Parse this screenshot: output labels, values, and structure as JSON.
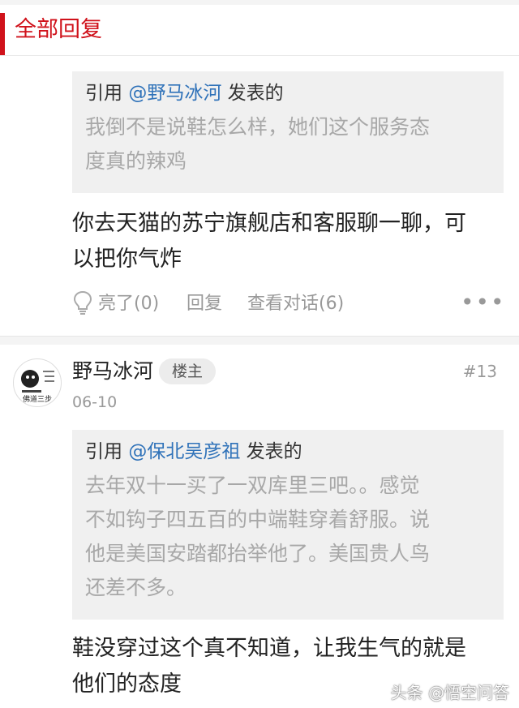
{
  "header": {
    "title": "全部回复"
  },
  "reply1": {
    "quote_prefix": "引用 ",
    "quote_user": "@野马冰河",
    "quote_suffix": " 发表的",
    "quote_line1": "我倒不是说鞋怎么样，她们这个服务态",
    "quote_line2": "度真的辣鸡",
    "body_line1": "你去天猫的苏宁旗舰店和客服聊一聊，可",
    "body_line2": "以把你气炸",
    "like_label": "亮了(0)",
    "reply_label": "回复",
    "dialog_label": "查看对话(6)",
    "more_glyph": "•••"
  },
  "reply2": {
    "username": "野马冰河",
    "badge": "楼主",
    "floor": "#13",
    "date": "06-10",
    "avatar_text": "佛道三步",
    "quote_prefix": "引用 ",
    "quote_user": "@保北吴彦祖",
    "quote_suffix": " 发表的",
    "quote_line1": "去年双十一买了一双库里三吧。。感觉",
    "quote_line2": "不如钩子四五百的中端鞋穿着舒服。说",
    "quote_line3": "他是美国安踏都抬举他了。美国贵人鸟",
    "quote_line4": "还差不多。",
    "body_line1": "鞋没穿过这个真不知道，让我生气的就是",
    "body_line2": "他们的态度"
  },
  "watermark": "头条 @悟空问答",
  "colors": {
    "accent": "#d0121b",
    "link": "#2f72b9",
    "quote_bg": "#f0f0f0"
  }
}
